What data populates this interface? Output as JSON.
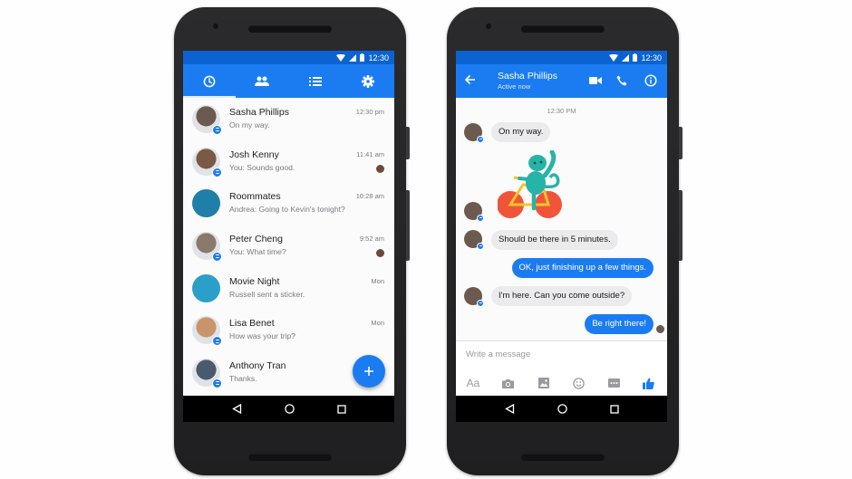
{
  "status_bar": {
    "time": "12:30"
  },
  "inbox": {
    "tabs": [
      {
        "name": "recent",
        "icon": "clock-icon",
        "active": true
      },
      {
        "name": "people",
        "icon": "people-icon",
        "active": false
      },
      {
        "name": "groups",
        "icon": "list-icon",
        "active": false
      },
      {
        "name": "settings",
        "icon": "gear-icon",
        "active": false
      }
    ],
    "conversations": [
      {
        "name": "Sasha Phillips",
        "preview": "On my way.",
        "time": "12:30 pm",
        "avatar_color": "#6d5a4e",
        "messenger_badge": true,
        "read_receipt": false
      },
      {
        "name": "Josh Kenny",
        "preview": "You: Sounds good.",
        "time": "11:41 am",
        "avatar_color": "#7a5a45",
        "messenger_badge": true,
        "read_receipt": true
      },
      {
        "name": "Roommates",
        "preview": "Andrea: Going to Kevin's tonight?",
        "time": "10:28 am",
        "avatar_color": "#1f7fa8",
        "messenger_badge": false,
        "read_receipt": false
      },
      {
        "name": "Peter Cheng",
        "preview": "You: What time?",
        "time": "9:52 am",
        "avatar_color": "#8a7a6a",
        "messenger_badge": true,
        "read_receipt": true
      },
      {
        "name": "Movie Night",
        "preview": "Russell sent a sticker.",
        "time": "Mon",
        "avatar_color": "#2aa0c8",
        "messenger_badge": false,
        "read_receipt": false
      },
      {
        "name": "Lisa Benet",
        "preview": "How was your trip?",
        "time": "Mon",
        "avatar_color": "#c8956a",
        "messenger_badge": true,
        "read_receipt": false
      },
      {
        "name": "Anthony Tran",
        "preview": "Thanks.",
        "time": "",
        "avatar_color": "#4a5a6e",
        "messenger_badge": true,
        "read_receipt": false
      }
    ],
    "fab_label": "+"
  },
  "chat": {
    "contact_name": "Sasha Phillips",
    "contact_status": "Active now",
    "timestamp": "12:30 PM",
    "messages": [
      {
        "from": "them",
        "text": "On my way."
      },
      {
        "from": "them",
        "type": "sticker",
        "sticker": "monkey-riding-bicycle"
      },
      {
        "from": "them",
        "text": "Should be there in 5 minutes."
      },
      {
        "from": "me",
        "text": "OK, just finishing up a few things."
      },
      {
        "from": "them",
        "text": "I'm here. Can you come outside?"
      },
      {
        "from": "me",
        "text": "Be right there!"
      }
    ],
    "composer": {
      "placeholder": "Write a message",
      "font_label": "Aa",
      "tools": [
        "text-format",
        "camera",
        "gallery",
        "emoji",
        "more",
        "like"
      ]
    }
  },
  "colors": {
    "brand_blue": "#1b7cf2",
    "status_bar_blue": "#0b63d1",
    "incoming_bubble": "#ebebee",
    "phone_body": "#252527"
  }
}
